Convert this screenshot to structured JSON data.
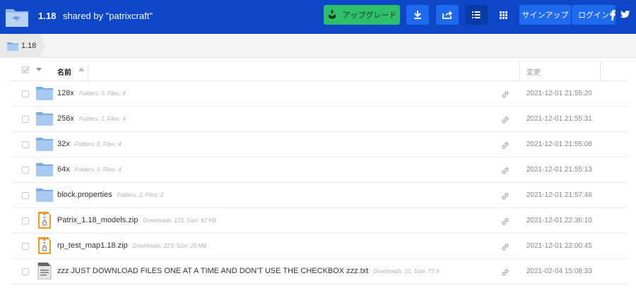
{
  "header": {
    "version": "1.18",
    "shared_by": "shared by \"patrixcraft\"",
    "upgrade_label": "アップグレード",
    "signup_label": "サインアップ",
    "login_label": "ログインする",
    "icons": [
      "dropbox-logo-icon",
      "download-icon",
      "share-icon",
      "list-view-icon",
      "grid-view-icon",
      "facebook-icon",
      "twitter-icon"
    ],
    "colors": {
      "bar": "#0d47c8",
      "upgrade": "#2fbf6c",
      "button": "#1e6bf0"
    }
  },
  "breadcrumb": {
    "label": "1.18"
  },
  "table": {
    "col_name": "名前",
    "col_modified": "変更",
    "rows": [
      {
        "name": "128x",
        "meta": "Folders: 0, Files: 4",
        "date": "2021-12-01 21:55:20",
        "type": "folder"
      },
      {
        "name": "256x",
        "meta": "Folders: 1, Files: 4",
        "date": "2021-12-01 21:55:31",
        "type": "folder"
      },
      {
        "name": "32x",
        "meta": "Folders: 0, Files: 4",
        "date": "2021-12-01 21:55:08",
        "type": "folder"
      },
      {
        "name": "64x",
        "meta": "Folders: 0, Files: 4",
        "date": "2021-12-01 21:55:13",
        "type": "folder"
      },
      {
        "name": "block.properties",
        "meta": "Folders: 2, Files: 2",
        "date": "2021-12-01 21:57:46",
        "type": "folder"
      },
      {
        "name": "Patrix_1.18_models.zip",
        "meta": "Downloads: 123, Size: 62 KB",
        "date": "2021-12-01 22:36:10",
        "type": "zip"
      },
      {
        "name": "rp_test_map1.18.zip",
        "meta": "Downloads: 223, Size: 20 MB",
        "date": "2021-12-01 22:00:45",
        "type": "zip"
      },
      {
        "name": "zzz JUST DOWNLOAD FILES ONE AT A TIME AND DON'T USE THE CHECKBOX zzz.txt",
        "meta": "Downloads: 10, Size: 73 b",
        "date": "2021-02-04 15:08:33",
        "type": "txt"
      }
    ]
  }
}
